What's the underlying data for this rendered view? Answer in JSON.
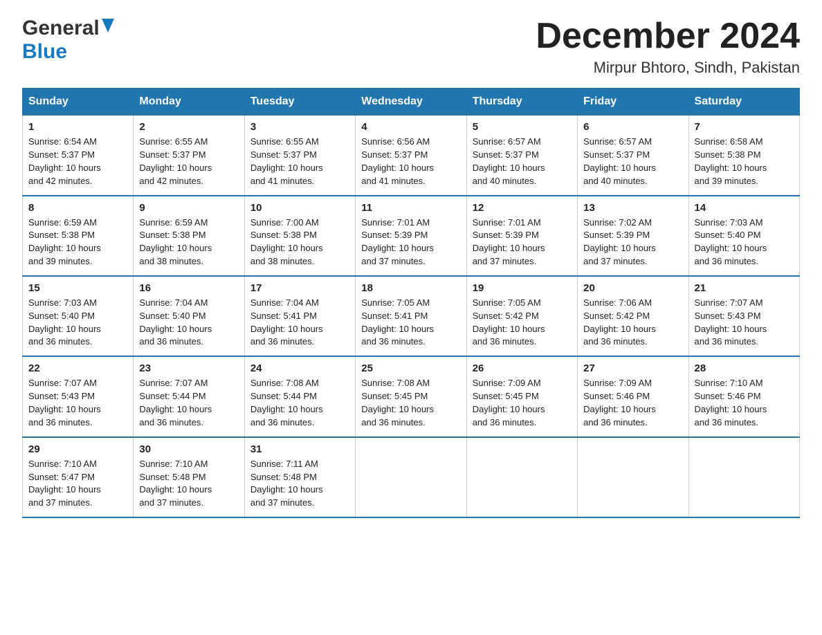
{
  "header": {
    "logo_general": "General",
    "logo_blue": "Blue",
    "month_title": "December 2024",
    "location": "Mirpur Bhtoro, Sindh, Pakistan"
  },
  "days_of_week": [
    "Sunday",
    "Monday",
    "Tuesday",
    "Wednesday",
    "Thursday",
    "Friday",
    "Saturday"
  ],
  "weeks": [
    [
      {
        "day": "1",
        "sunrise": "6:54 AM",
        "sunset": "5:37 PM",
        "daylight": "10 hours and 42 minutes."
      },
      {
        "day": "2",
        "sunrise": "6:55 AM",
        "sunset": "5:37 PM",
        "daylight": "10 hours and 42 minutes."
      },
      {
        "day": "3",
        "sunrise": "6:55 AM",
        "sunset": "5:37 PM",
        "daylight": "10 hours and 41 minutes."
      },
      {
        "day": "4",
        "sunrise": "6:56 AM",
        "sunset": "5:37 PM",
        "daylight": "10 hours and 41 minutes."
      },
      {
        "day": "5",
        "sunrise": "6:57 AM",
        "sunset": "5:37 PM",
        "daylight": "10 hours and 40 minutes."
      },
      {
        "day": "6",
        "sunrise": "6:57 AM",
        "sunset": "5:37 PM",
        "daylight": "10 hours and 40 minutes."
      },
      {
        "day": "7",
        "sunrise": "6:58 AM",
        "sunset": "5:38 PM",
        "daylight": "10 hours and 39 minutes."
      }
    ],
    [
      {
        "day": "8",
        "sunrise": "6:59 AM",
        "sunset": "5:38 PM",
        "daylight": "10 hours and 39 minutes."
      },
      {
        "day": "9",
        "sunrise": "6:59 AM",
        "sunset": "5:38 PM",
        "daylight": "10 hours and 38 minutes."
      },
      {
        "day": "10",
        "sunrise": "7:00 AM",
        "sunset": "5:38 PM",
        "daylight": "10 hours and 38 minutes."
      },
      {
        "day": "11",
        "sunrise": "7:01 AM",
        "sunset": "5:39 PM",
        "daylight": "10 hours and 37 minutes."
      },
      {
        "day": "12",
        "sunrise": "7:01 AM",
        "sunset": "5:39 PM",
        "daylight": "10 hours and 37 minutes."
      },
      {
        "day": "13",
        "sunrise": "7:02 AM",
        "sunset": "5:39 PM",
        "daylight": "10 hours and 37 minutes."
      },
      {
        "day": "14",
        "sunrise": "7:03 AM",
        "sunset": "5:40 PM",
        "daylight": "10 hours and 36 minutes."
      }
    ],
    [
      {
        "day": "15",
        "sunrise": "7:03 AM",
        "sunset": "5:40 PM",
        "daylight": "10 hours and 36 minutes."
      },
      {
        "day": "16",
        "sunrise": "7:04 AM",
        "sunset": "5:40 PM",
        "daylight": "10 hours and 36 minutes."
      },
      {
        "day": "17",
        "sunrise": "7:04 AM",
        "sunset": "5:41 PM",
        "daylight": "10 hours and 36 minutes."
      },
      {
        "day": "18",
        "sunrise": "7:05 AM",
        "sunset": "5:41 PM",
        "daylight": "10 hours and 36 minutes."
      },
      {
        "day": "19",
        "sunrise": "7:05 AM",
        "sunset": "5:42 PM",
        "daylight": "10 hours and 36 minutes."
      },
      {
        "day": "20",
        "sunrise": "7:06 AM",
        "sunset": "5:42 PM",
        "daylight": "10 hours and 36 minutes."
      },
      {
        "day": "21",
        "sunrise": "7:07 AM",
        "sunset": "5:43 PM",
        "daylight": "10 hours and 36 minutes."
      }
    ],
    [
      {
        "day": "22",
        "sunrise": "7:07 AM",
        "sunset": "5:43 PM",
        "daylight": "10 hours and 36 minutes."
      },
      {
        "day": "23",
        "sunrise": "7:07 AM",
        "sunset": "5:44 PM",
        "daylight": "10 hours and 36 minutes."
      },
      {
        "day": "24",
        "sunrise": "7:08 AM",
        "sunset": "5:44 PM",
        "daylight": "10 hours and 36 minutes."
      },
      {
        "day": "25",
        "sunrise": "7:08 AM",
        "sunset": "5:45 PM",
        "daylight": "10 hours and 36 minutes."
      },
      {
        "day": "26",
        "sunrise": "7:09 AM",
        "sunset": "5:45 PM",
        "daylight": "10 hours and 36 minutes."
      },
      {
        "day": "27",
        "sunrise": "7:09 AM",
        "sunset": "5:46 PM",
        "daylight": "10 hours and 36 minutes."
      },
      {
        "day": "28",
        "sunrise": "7:10 AM",
        "sunset": "5:46 PM",
        "daylight": "10 hours and 36 minutes."
      }
    ],
    [
      {
        "day": "29",
        "sunrise": "7:10 AM",
        "sunset": "5:47 PM",
        "daylight": "10 hours and 37 minutes."
      },
      {
        "day": "30",
        "sunrise": "7:10 AM",
        "sunset": "5:48 PM",
        "daylight": "10 hours and 37 minutes."
      },
      {
        "day": "31",
        "sunrise": "7:11 AM",
        "sunset": "5:48 PM",
        "daylight": "10 hours and 37 minutes."
      },
      null,
      null,
      null,
      null
    ]
  ],
  "labels": {
    "sunrise": "Sunrise:",
    "sunset": "Sunset:",
    "daylight": "Daylight:"
  }
}
